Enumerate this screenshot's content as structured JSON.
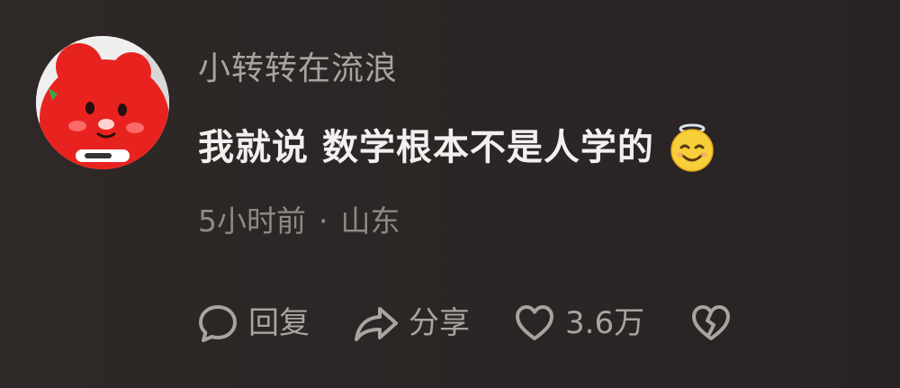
{
  "comment": {
    "username": "小转转在流浪",
    "text": "我就说 数学根本不是人学的",
    "emoji": "smiling-halo-emoji",
    "time": "5小时前",
    "separator": "·",
    "location": "山东"
  },
  "actions": {
    "reply_label": "回复",
    "share_label": "分享",
    "like_count": "3.6万",
    "reply_icon": "speech-bubble-icon",
    "share_icon": "share-arrow-icon",
    "like_icon": "heart-icon",
    "dislike_icon": "broken-heart-icon"
  },
  "colors": {
    "background": "#2b2625",
    "username": "#a9a3a1",
    "text": "#f2f0ef",
    "meta": "#8e8886",
    "avatar_red": "#e8231f"
  }
}
